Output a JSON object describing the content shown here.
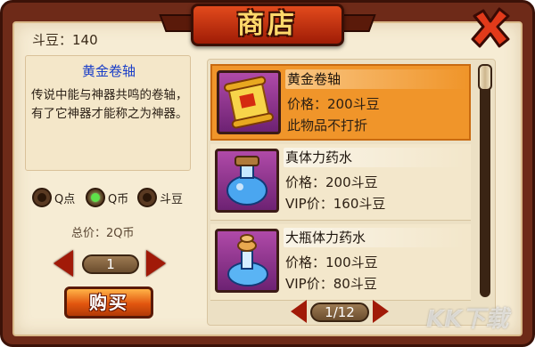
{
  "title": "商店",
  "beans_label": "斗豆：140",
  "description": {
    "name": "黄金卷轴",
    "text": "传说中能与神器共鸣的卷轴，有了它神器才能称之为神器。"
  },
  "currency_options": [
    {
      "label": "Q点",
      "selected": false
    },
    {
      "label": "Q币",
      "selected": true
    },
    {
      "label": "斗豆",
      "selected": false
    }
  ],
  "total_label": "总价：2Q币",
  "quantity": "1",
  "buy_label": "购买",
  "items": [
    {
      "name": "黄金卷轴",
      "line2": "价格：200斗豆",
      "line3": "此物品不打折",
      "icon": "golden-scroll-icon",
      "selected": true
    },
    {
      "name": "真体力药水",
      "line2": "价格：200斗豆",
      "line3": "VIP价：160斗豆",
      "icon": "blue-potion-icon",
      "selected": false
    },
    {
      "name": "大瓶体力药水",
      "line2": "价格：100斗豆",
      "line3": "VIP价：80斗豆",
      "icon": "large-potion-icon",
      "selected": false
    }
  ],
  "pagination": "1/12",
  "watermark": "KK下载",
  "colors": {
    "accent": "#f0952a",
    "frame": "#6e2a18",
    "title": "#ffd86b"
  }
}
